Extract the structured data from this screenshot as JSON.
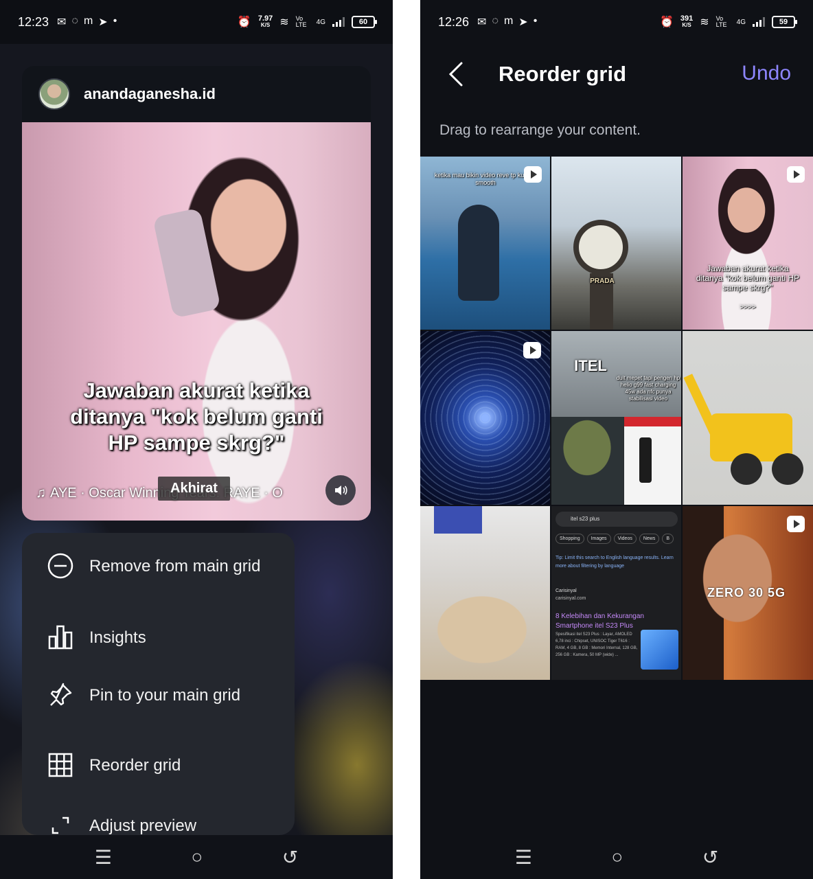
{
  "left": {
    "status": {
      "time": "12:23",
      "net_speed": "7.97",
      "net_unit": "K/S",
      "volte": "Vo LTE",
      "network": "4G",
      "battery": "60"
    },
    "post": {
      "username": "anandaganesha.id",
      "caption": "Jawaban akurat ketika ditanya \"kok belum ganti HP sampe skrg?\"",
      "music_text": "AYE · Oscar Winning Tears.    RAYE · O",
      "music_label": "Akhirat"
    },
    "menu": {
      "items": [
        {
          "label": "Remove from main grid",
          "icon": "minus-circle-icon"
        },
        {
          "label": "Insights",
          "icon": "bar-chart-icon"
        },
        {
          "label": "Pin to your main grid",
          "icon": "pin-icon"
        },
        {
          "label": "Reorder grid",
          "icon": "grid-icon"
        },
        {
          "label": "Adjust preview",
          "icon": "crop-icon"
        }
      ]
    }
  },
  "right": {
    "status": {
      "time": "12:26",
      "net_speed": "391",
      "net_unit": "K/S",
      "volte": "Vo LTE",
      "network": "4G",
      "battery": "59"
    },
    "header": {
      "title": "Reorder grid",
      "undo_label": "Undo"
    },
    "hint": "Drag to rearrange your content.",
    "tiles": {
      "t1_text": "ketika mau bikin video reve tp kurang smooth",
      "t2_text": "PRADA",
      "t3_text": "Jawaban akurat ketika ditanya \"kok belum ganti HP sampe skrg?\"",
      "t3_arrows": ">>>>",
      "t5_title": "ITEL",
      "t5_text": "duit mepet tapi pengen hp helio g99 fast charging 45w ada nfc punya stabilisasi video",
      "t8_search": "itel s23 plus",
      "t8_chips": [
        "Shopping",
        "Images",
        "Videos",
        "News",
        "B"
      ],
      "t8_tip": "Tip: Limit this search to English language results. Learn more about filtering by language",
      "t8_site": "Carisinyal",
      "t8_url": "carisinyal.com",
      "t8_title": "8 Kelebihan dan Kekurangan Smartphone itel S23 Plus",
      "t8_snippet": "Spesifikasi itel S23 Plus : Layar, AMOLED 6,78 inci : Chipset, UNISOC Tiger T616 : RAM, 4 GB, 8 GB : Memori Internal, 128 GB, 256 GB : Kamera, 50 MP (wide) ...",
      "t9_text": "ZERO 30 5G"
    }
  },
  "nav": {
    "menu": "☰",
    "home": "○",
    "back": "↺"
  }
}
